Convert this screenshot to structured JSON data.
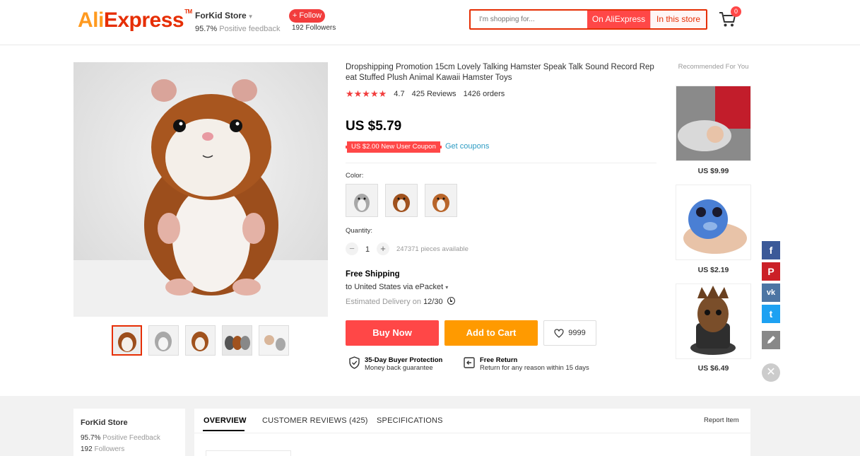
{
  "header": {
    "logo_ali": "Ali",
    "logo_express": "Express",
    "logo_tm": "TM",
    "store_name": "ForKid Store",
    "feedback_pct": "95.7%",
    "feedback_label": "Positive feedback",
    "follow_label": "+ Follow",
    "followers": "192 Followers",
    "search_placeholder": "I'm shopping for...",
    "search_on_ali": "On AliExpress",
    "search_in_store": "In this store",
    "cart_count": "0"
  },
  "product": {
    "title": "Dropshipping Promotion 15cm Lovely Talking Hamster Speak Talk Sound Record Repeat Stuffed Plush Animal Kawaii Hamster Toys",
    "stars": "★★★★★",
    "rating": "4.7",
    "reviews": "425 Reviews",
    "orders": "1426 orders",
    "price": "US $5.79",
    "coupon": "US $2.00 New User Coupon",
    "get_coupons": "Get coupons",
    "color_label": "Color:",
    "quantity_label": "Quantity:",
    "quantity": "1",
    "quantity_minus": "−",
    "quantity_plus": "+",
    "available": "247371 pieces available",
    "shipping_title": "Free Shipping",
    "shipping_to": "to United States via ePacket",
    "eta_prefix": "Estimated Delivery on",
    "eta_date": "12/30",
    "buy_now": "Buy Now",
    "add_to_cart": "Add to Cart",
    "wishlist_count": "9999",
    "protection_title": "35-Day Buyer Protection",
    "protection_sub": "Money back guarantee",
    "return_title": "Free Return",
    "return_sub": "Return for any reason within 15 days"
  },
  "recommended": {
    "title": "Recommended For You",
    "items": [
      {
        "price": "US $9.99"
      },
      {
        "price": "US $2.19"
      },
      {
        "price": "US $6.49"
      }
    ]
  },
  "social": {
    "facebook": "f",
    "pinterest": "P",
    "vk": "vk",
    "twitter": "t",
    "close": "✕"
  },
  "store_card": {
    "name": "ForKid Store",
    "feedback_pct": "95.7%",
    "feedback_label": "Positive Feedback",
    "followers_count": "192",
    "followers_label": "Followers"
  },
  "tabs": {
    "overview": "OVERVIEW",
    "reviews": "CUSTOMER REVIEWS (425)",
    "specs": "SPECIFICATIONS",
    "report": "Report Item"
  },
  "colors": {
    "accent_red": "#ff4747",
    "brand_orange": "#ff9a1f",
    "link_blue": "#2e9cc3"
  }
}
